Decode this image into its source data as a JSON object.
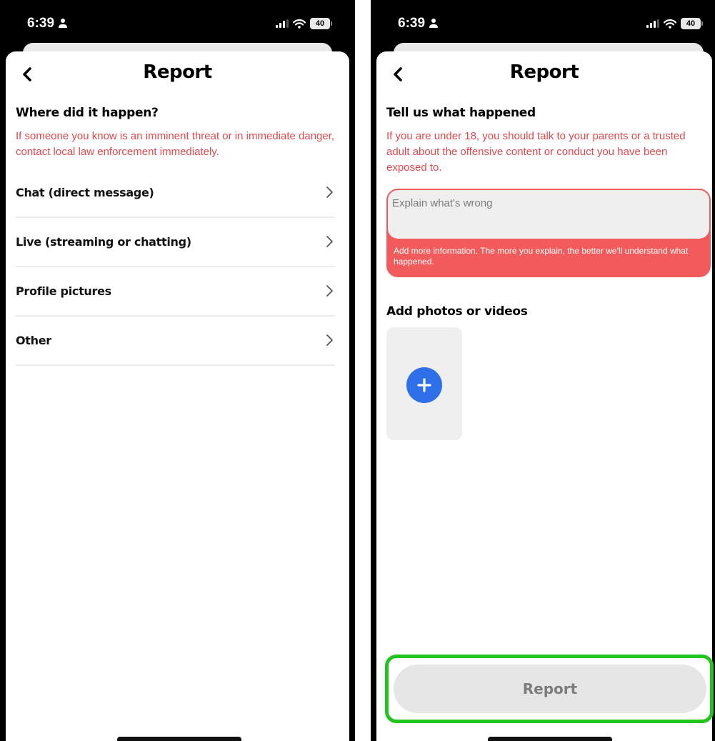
{
  "left": {
    "status": {
      "time": "6:39",
      "battery": "40"
    },
    "title": "Report",
    "section_title": "Where did it happen?",
    "warning": "If someone you know is an imminent threat or in immediate danger, contact local law enforcement immediately.",
    "items": [
      {
        "label": "Chat (direct message)"
      },
      {
        "label": "Live (streaming or chatting)"
      },
      {
        "label": "Profile pictures"
      },
      {
        "label": "Other"
      }
    ]
  },
  "right": {
    "status": {
      "time": "6:39",
      "battery": "40"
    },
    "title": "Report",
    "section_title": "Tell us what happened",
    "warning": "If you are under 18, you should talk to your parents or a trusted adult about the offensive content or conduct you have been exposed to.",
    "textarea_placeholder": "Explain what's wrong",
    "textarea_hint": "Add more information. The more you explain, the better we'll understand what happened.",
    "media_title": "Add photos or videos",
    "submit_label": "Report"
  },
  "colors": {
    "warning": "#e0484e",
    "error_box": "#f25b5b",
    "plus_button": "#2f6fe8",
    "highlight_outline": "#22c51e"
  },
  "icons": [
    "person-icon",
    "signal-icon",
    "wifi-icon",
    "battery-icon",
    "chevron-left-icon",
    "chevron-right-icon",
    "plus-icon"
  ]
}
